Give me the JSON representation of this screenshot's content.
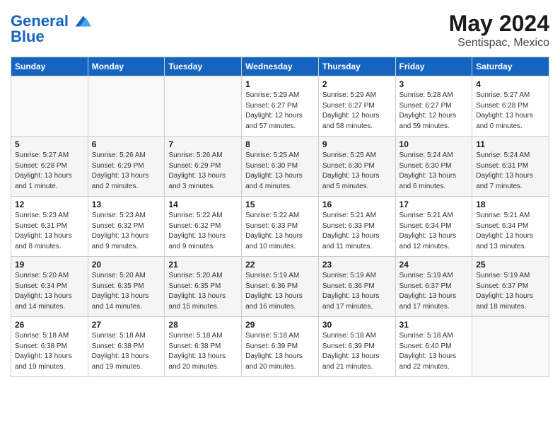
{
  "header": {
    "logo_line1": "General",
    "logo_line2": "Blue",
    "month": "May 2024",
    "location": "Sentispac, Mexico"
  },
  "weekdays": [
    "Sunday",
    "Monday",
    "Tuesday",
    "Wednesday",
    "Thursday",
    "Friday",
    "Saturday"
  ],
  "weeks": [
    [
      {
        "day": "",
        "info": ""
      },
      {
        "day": "",
        "info": ""
      },
      {
        "day": "",
        "info": ""
      },
      {
        "day": "1",
        "info": "Sunrise: 5:29 AM\nSunset: 6:27 PM\nDaylight: 12 hours\nand 57 minutes."
      },
      {
        "day": "2",
        "info": "Sunrise: 5:29 AM\nSunset: 6:27 PM\nDaylight: 12 hours\nand 58 minutes."
      },
      {
        "day": "3",
        "info": "Sunrise: 5:28 AM\nSunset: 6:27 PM\nDaylight: 12 hours\nand 59 minutes."
      },
      {
        "day": "4",
        "info": "Sunrise: 5:27 AM\nSunset: 6:28 PM\nDaylight: 13 hours\nand 0 minutes."
      }
    ],
    [
      {
        "day": "5",
        "info": "Sunrise: 5:27 AM\nSunset: 6:28 PM\nDaylight: 13 hours\nand 1 minute."
      },
      {
        "day": "6",
        "info": "Sunrise: 5:26 AM\nSunset: 6:29 PM\nDaylight: 13 hours\nand 2 minutes."
      },
      {
        "day": "7",
        "info": "Sunrise: 5:26 AM\nSunset: 6:29 PM\nDaylight: 13 hours\nand 3 minutes."
      },
      {
        "day": "8",
        "info": "Sunrise: 5:25 AM\nSunset: 6:30 PM\nDaylight: 13 hours\nand 4 minutes."
      },
      {
        "day": "9",
        "info": "Sunrise: 5:25 AM\nSunset: 6:30 PM\nDaylight: 13 hours\nand 5 minutes."
      },
      {
        "day": "10",
        "info": "Sunrise: 5:24 AM\nSunset: 6:30 PM\nDaylight: 13 hours\nand 6 minutes."
      },
      {
        "day": "11",
        "info": "Sunrise: 5:24 AM\nSunset: 6:31 PM\nDaylight: 13 hours\nand 7 minutes."
      }
    ],
    [
      {
        "day": "12",
        "info": "Sunrise: 5:23 AM\nSunset: 6:31 PM\nDaylight: 13 hours\nand 8 minutes."
      },
      {
        "day": "13",
        "info": "Sunrise: 5:23 AM\nSunset: 6:32 PM\nDaylight: 13 hours\nand 9 minutes."
      },
      {
        "day": "14",
        "info": "Sunrise: 5:22 AM\nSunset: 6:32 PM\nDaylight: 13 hours\nand 9 minutes."
      },
      {
        "day": "15",
        "info": "Sunrise: 5:22 AM\nSunset: 6:33 PM\nDaylight: 13 hours\nand 10 minutes."
      },
      {
        "day": "16",
        "info": "Sunrise: 5:21 AM\nSunset: 6:33 PM\nDaylight: 13 hours\nand 11 minutes."
      },
      {
        "day": "17",
        "info": "Sunrise: 5:21 AM\nSunset: 6:34 PM\nDaylight: 13 hours\nand 12 minutes."
      },
      {
        "day": "18",
        "info": "Sunrise: 5:21 AM\nSunset: 6:34 PM\nDaylight: 13 hours\nand 13 minutes."
      }
    ],
    [
      {
        "day": "19",
        "info": "Sunrise: 5:20 AM\nSunset: 6:34 PM\nDaylight: 13 hours\nand 14 minutes."
      },
      {
        "day": "20",
        "info": "Sunrise: 5:20 AM\nSunset: 6:35 PM\nDaylight: 13 hours\nand 14 minutes."
      },
      {
        "day": "21",
        "info": "Sunrise: 5:20 AM\nSunset: 6:35 PM\nDaylight: 13 hours\nand 15 minutes."
      },
      {
        "day": "22",
        "info": "Sunrise: 5:19 AM\nSunset: 6:36 PM\nDaylight: 13 hours\nand 16 minutes."
      },
      {
        "day": "23",
        "info": "Sunrise: 5:19 AM\nSunset: 6:36 PM\nDaylight: 13 hours\nand 17 minutes."
      },
      {
        "day": "24",
        "info": "Sunrise: 5:19 AM\nSunset: 6:37 PM\nDaylight: 13 hours\nand 17 minutes."
      },
      {
        "day": "25",
        "info": "Sunrise: 5:19 AM\nSunset: 6:37 PM\nDaylight: 13 hours\nand 18 minutes."
      }
    ],
    [
      {
        "day": "26",
        "info": "Sunrise: 5:18 AM\nSunset: 6:38 PM\nDaylight: 13 hours\nand 19 minutes."
      },
      {
        "day": "27",
        "info": "Sunrise: 5:18 AM\nSunset: 6:38 PM\nDaylight: 13 hours\nand 19 minutes."
      },
      {
        "day": "28",
        "info": "Sunrise: 5:18 AM\nSunset: 6:38 PM\nDaylight: 13 hours\nand 20 minutes."
      },
      {
        "day": "29",
        "info": "Sunrise: 5:18 AM\nSunset: 6:39 PM\nDaylight: 13 hours\nand 20 minutes."
      },
      {
        "day": "30",
        "info": "Sunrise: 5:18 AM\nSunset: 6:39 PM\nDaylight: 13 hours\nand 21 minutes."
      },
      {
        "day": "31",
        "info": "Sunrise: 5:18 AM\nSunset: 6:40 PM\nDaylight: 13 hours\nand 22 minutes."
      },
      {
        "day": "",
        "info": ""
      }
    ]
  ]
}
